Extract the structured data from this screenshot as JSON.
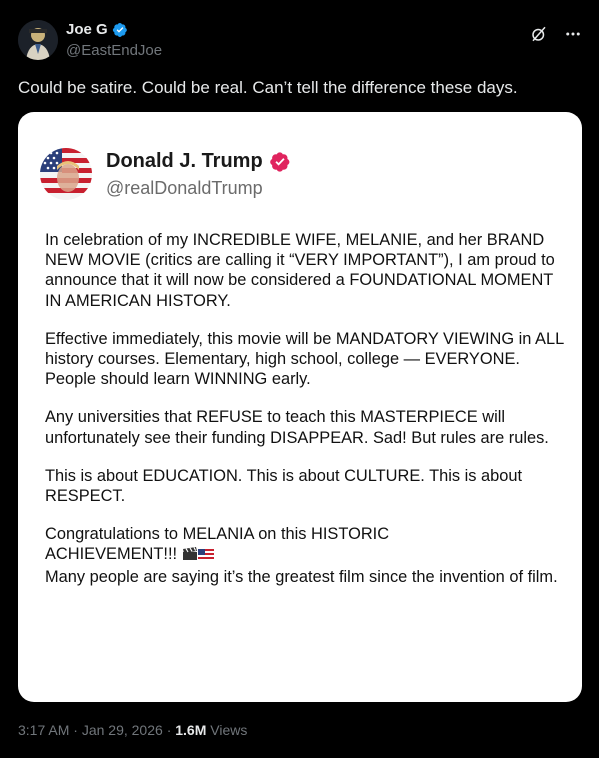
{
  "author": {
    "name": "Joe G",
    "handle": "@EastEndJoe",
    "verified_color": "#1d9bf0",
    "avatar_icon": "avatar-icon"
  },
  "header_actions": {
    "grok_icon": "grok-icon",
    "more_icon": "more-icon"
  },
  "tweet": {
    "text": "Could be satire. Could be real. Can’t tell the difference these days."
  },
  "embed": {
    "name": "Donald J. Trump",
    "handle": "@realDonaldTrump",
    "verified_color": "#e0245e",
    "avatar_icon": "flag-portrait-avatar-icon",
    "paragraphs": [
      "In celebration of my INCREDIBLE WIFE, MELANIE, and her BRAND NEW MOVIE (critics are calling it “VERY IMPORTANT”), I am proud to announce that it will now be considered a FOUNDATIONAL MOMENT IN AMERICAN HISTORY.",
      "Effective immediately, this movie will be MANDATORY VIEWING in ALL history courses. Elementary, high school, college — EVERYONE. People should learn WINNING early.",
      "Any universities that REFUSE to teach this MASTERPIECE will unfortunately see their funding DISAPPEAR. Sad! But rules are rules.",
      "This is about EDUCATION. This is about CULTURE. This is about RESPECT."
    ],
    "last_paragraph_line1": "Congratulations to MELANIA on this HISTORIC",
    "last_paragraph_line2": "ACHIEVEMENT!!!",
    "emoji_icons": [
      "clapperboard-icon",
      "us-flag-icon"
    ],
    "last_paragraph_rest": "Many people are saying it’s the greatest film since the invention of film."
  },
  "meta": {
    "time": "3:17 AM",
    "separator": "·",
    "date": "Jan 29, 2026",
    "views_count": "1.6M",
    "views_label": "Views"
  }
}
